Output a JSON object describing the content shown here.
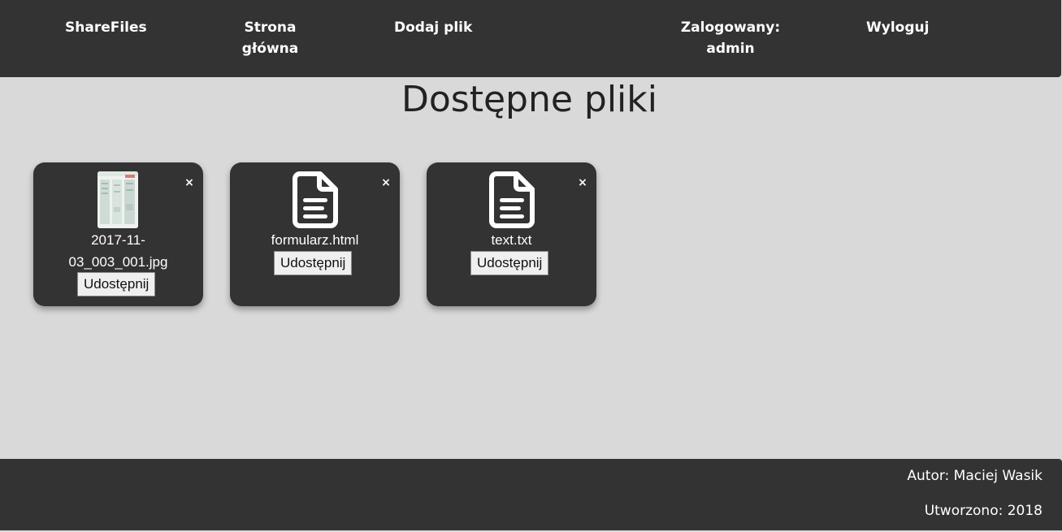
{
  "header": {
    "brand": "ShareFiles",
    "nav": {
      "home_line1": "Strona",
      "home_line2": "główna",
      "add_file": "Dodaj plik",
      "logged_in_line1": "Zalogowany:",
      "logged_in_line2": "admin",
      "logout": "Wyloguj"
    }
  },
  "main": {
    "title": "Dostępne pliki",
    "files": [
      {
        "name_line1": "2017-11-",
        "name_line2": "03_003_001.jpg",
        "share_label": "Udostępnij",
        "close_label": "×",
        "icon": "image-thumbnail"
      },
      {
        "name": "formularz.html",
        "share_label": "Udostępnij",
        "close_label": "×",
        "icon": "document-icon"
      },
      {
        "name": "text.txt",
        "share_label": "Udostępnij",
        "close_label": "×",
        "icon": "document-icon"
      }
    ]
  },
  "footer": {
    "author": "Autor: Maciej Wasik",
    "created": "Utworzono: 2018"
  },
  "colors": {
    "background": "#d9d9d9",
    "panel": "#333333",
    "text_light": "#ffffff",
    "button_bg": "#efefef"
  }
}
